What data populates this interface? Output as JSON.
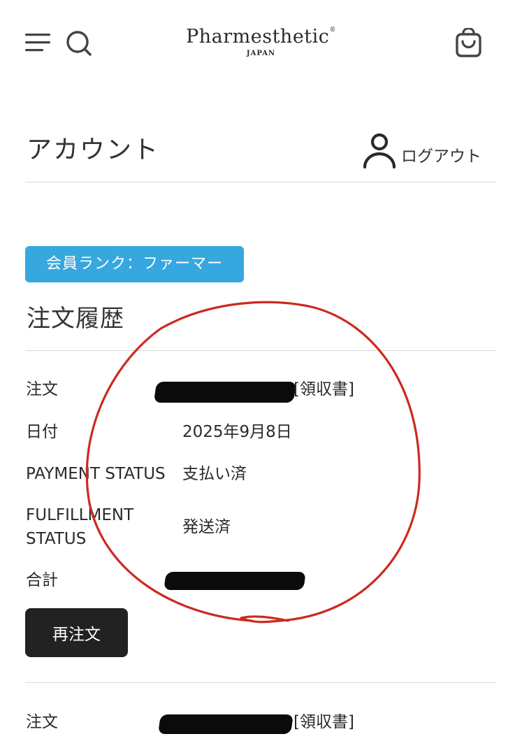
{
  "header": {
    "logo_name": "Pharmesthetic",
    "logo_reg": "®",
    "logo_sub": "JAPAN",
    "icons": [
      "menu-icon",
      "search-icon",
      "cart-icon"
    ]
  },
  "account": {
    "title": "アカウント",
    "logout_label": "ログアウト",
    "logout_icon": "user-icon"
  },
  "member_rank": {
    "label": "会員ランク：ファーマー",
    "color": "#37a7df"
  },
  "orders": {
    "title": "注文履歴",
    "items": [
      {
        "order_label": "注文",
        "receipt_label": "[領収書]",
        "date_label": "日付",
        "date_value": "2025年9月8日",
        "payment_label": "PAYMENT STATUS",
        "payment_value": "支払い済",
        "fulfillment_label_1": "FULFILLMENT",
        "fulfillment_label_2": "STATUS",
        "fulfillment_value": "発送済",
        "total_label": "合計",
        "reorder_label": "再注文"
      },
      {
        "order_label": "注文",
        "receipt_label": "[領収書]"
      }
    ]
  },
  "colors": {
    "accent": "#37a7df",
    "button_dark": "#222222",
    "annotation_red": "#cc2a1f",
    "redaction": "#0b0b0b"
  }
}
